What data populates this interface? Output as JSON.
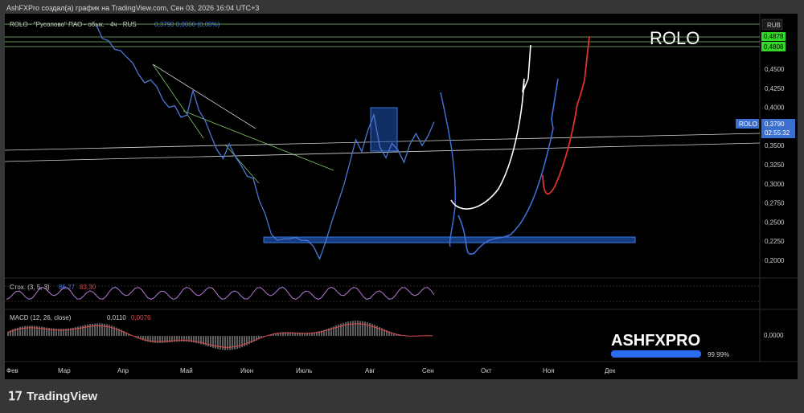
{
  "header": "AshFXPro создал(а) график на TradingView.com, Сен 03, 2026 16:04 UTC+3",
  "brand": {
    "icon": "tradingview-logo-icon",
    "text": "TradingView"
  },
  "watermark": {
    "symbol": "ROLO",
    "logo": "ASHFXPRO",
    "progress_label": "99.99%",
    "progress": 0.9999
  },
  "legend": {
    "name": "ROLO · \"Русолово\" ПАО - обык. · 4ч · RUS",
    "values": "0,3790  0,0000 (0,00%)"
  },
  "price_axis": {
    "currency": "RUB",
    "ticks": [
      "0,4500",
      "0,4250",
      "0,4000",
      "0,3750",
      "0,3500",
      "0,3250",
      "0,3000",
      "0,2750",
      "0,2500",
      "0,2250",
      "0,2000"
    ],
    "top_label_1": "0,4878",
    "top_label_2": "0,4808",
    "symbol_tag": "ROLO",
    "last_price": "0,3790",
    "countdown": "02:55:32"
  },
  "colors": {
    "price_line": "#4a78d6",
    "hline_green": "#7fc66a",
    "accent_green": "#35d62a",
    "accent_red": "#e03030",
    "stoch_k": "#b57ad6",
    "macd_line": "#e04a4a"
  },
  "stoch": {
    "label": "Стох. (3, 5, 3)",
    "k": "86,27",
    "d": "83,30"
  },
  "macd": {
    "label": "MACD (12, 26, close)",
    "v1": "0,0110",
    "v2": "0,0076",
    "axis_zero": "0,0000"
  },
  "time_axis": [
    "Фев",
    "Мар",
    "Апр",
    "Май",
    "Июн",
    "Июль",
    "Авг",
    "Сен",
    "Окт",
    "Ноя",
    "Дек"
  ],
  "chart_data": {
    "type": "line",
    "title": "ROLO",
    "series": [
      {
        "name": "ROLO",
        "points": [
          [
            "Фев",
            0.505
          ],
          [
            "Мар",
            0.492
          ],
          [
            "Мар",
            0.485
          ],
          [
            "Мар",
            0.478
          ],
          [
            "Апр",
            0.472
          ],
          [
            "Апр",
            0.468
          ],
          [
            "Апр",
            0.456
          ],
          [
            "Апр",
            0.445
          ],
          [
            "Апр",
            0.43
          ],
          [
            "Апр",
            0.438
          ],
          [
            "Май",
            0.425
          ],
          [
            "Май",
            0.412
          ],
          [
            "Май",
            0.398
          ],
          [
            "Май",
            0.404
          ],
          [
            "Май",
            0.385
          ],
          [
            "Май",
            0.392
          ],
          [
            "Май",
            0.42
          ],
          [
            "Май",
            0.398
          ],
          [
            "Июн",
            0.381
          ],
          [
            "Июн",
            0.365
          ],
          [
            "Июн",
            0.342
          ],
          [
            "Июн",
            0.335
          ],
          [
            "Июн",
            0.35
          ],
          [
            "Июн",
            0.338
          ],
          [
            "Июн",
            0.322
          ],
          [
            "Июн",
            0.312
          ],
          [
            "Июль",
            0.305
          ],
          [
            "Июль",
            0.28
          ],
          [
            "Июль",
            0.258
          ],
          [
            "Июль",
            0.236
          ],
          [
            "Июль",
            0.224
          ],
          [
            "Июль",
            0.23
          ],
          [
            "Июль",
            0.226
          ],
          [
            "Июль",
            0.232
          ],
          [
            "Июль",
            0.224
          ],
          [
            "Июль",
            0.228
          ],
          [
            "Авг",
            0.216
          ],
          [
            "Авг",
            0.204
          ],
          [
            "Авг",
            0.222
          ],
          [
            "Авг",
            0.252
          ],
          [
            "Авг",
            0.272
          ],
          [
            "Авг",
            0.3
          ],
          [
            "Авг",
            0.325
          ],
          [
            "Авг",
            0.36
          ],
          [
            "Авг",
            0.34
          ],
          [
            "Авг",
            0.372
          ],
          [
            "Авг",
            0.388
          ],
          [
            "Авг",
            0.35
          ],
          [
            "Авг",
            0.332
          ],
          [
            "Авг",
            0.355
          ],
          [
            "Авг",
            0.342
          ],
          [
            "Сен",
            0.33
          ],
          [
            "Сен",
            0.35
          ],
          [
            "Сен",
            0.368
          ],
          [
            "Сен",
            0.348
          ],
          [
            "Сен",
            0.365
          ],
          [
            "Сен",
            0.379
          ]
        ]
      }
    ],
    "horizontal_levels": [
      0.4878,
      0.4808
    ],
    "support_zone": [
      0.222,
      0.228
    ],
    "ylim": [
      0.2,
      0.49
    ],
    "grid": false
  }
}
